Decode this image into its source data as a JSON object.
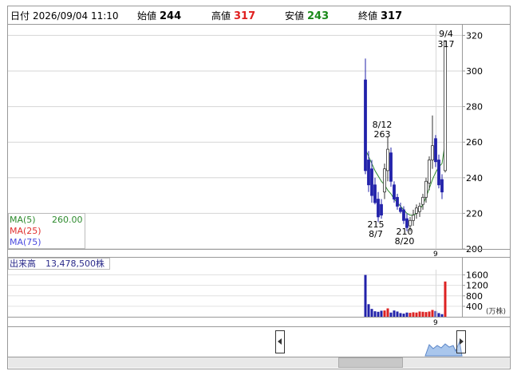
{
  "header": {
    "date_label": "日付",
    "datetime": "2026/09/04 11:10",
    "open_label": "始値",
    "open_value": "244",
    "high_label": "高値",
    "high_value": "317",
    "low_label": "安値",
    "low_value": "243",
    "close_label": "終値",
    "close_value": "317"
  },
  "ma_legend": {
    "ma5_label": "MA(5)",
    "ma5_value": "260.00",
    "ma25_label": "MA(25)",
    "ma75_label": "MA(75)"
  },
  "volume_label": "出来高",
  "volume_value": "13,478,500株",
  "volume_unit": "(万株)",
  "colors": {
    "up": "#ffffff",
    "down": "#2222aa",
    "ma5": "#2e8b2e",
    "ma25": "#e03030",
    "ma75": "#4a4ae0",
    "vol_up": "#dd2222",
    "vol_down": "#2222aa"
  },
  "chart_data": [
    {
      "type": "candlestick",
      "y_ticks": [
        "320",
        "300",
        "280",
        "260",
        "240",
        "220",
        "200"
      ],
      "ylim": [
        200,
        326
      ],
      "x_tick_label": "9",
      "annotations": [
        {
          "date": "9/4",
          "price": "317"
        },
        {
          "date": "8/12",
          "price": "263"
        },
        {
          "date": "8/7",
          "price": "215"
        },
        {
          "date": "8/20",
          "price": "210"
        }
      ],
      "candles": [
        {
          "o": 295,
          "h": 307,
          "l": 242,
          "c": 244
        },
        {
          "o": 250,
          "h": 255,
          "l": 232,
          "c": 236
        },
        {
          "o": 245,
          "h": 250,
          "l": 226,
          "c": 230
        },
        {
          "o": 236,
          "h": 240,
          "l": 225,
          "c": 226
        },
        {
          "o": 228,
          "h": 232,
          "l": 215,
          "c": 218
        },
        {
          "o": 225,
          "h": 228,
          "l": 217,
          "c": 219
        },
        {
          "o": 232,
          "h": 248,
          "l": 228,
          "c": 245
        },
        {
          "o": 244,
          "h": 263,
          "l": 238,
          "c": 256
        },
        {
          "o": 254,
          "h": 257,
          "l": 235,
          "c": 238
        },
        {
          "o": 236,
          "h": 238,
          "l": 226,
          "c": 228
        },
        {
          "o": 229,
          "h": 231,
          "l": 222,
          "c": 224
        },
        {
          "o": 223,
          "h": 226,
          "l": 220,
          "c": 221
        },
        {
          "o": 222,
          "h": 224,
          "l": 214,
          "c": 216
        },
        {
          "o": 217,
          "h": 220,
          "l": 210,
          "c": 212
        },
        {
          "o": 213,
          "h": 218,
          "l": 210,
          "c": 216
        },
        {
          "o": 216,
          "h": 222,
          "l": 213,
          "c": 219
        },
        {
          "o": 220,
          "h": 225,
          "l": 217,
          "c": 223
        },
        {
          "o": 221,
          "h": 226,
          "l": 218,
          "c": 224
        },
        {
          "o": 225,
          "h": 231,
          "l": 222,
          "c": 229
        },
        {
          "o": 229,
          "h": 240,
          "l": 226,
          "c": 238
        },
        {
          "o": 237,
          "h": 252,
          "l": 233,
          "c": 250
        },
        {
          "o": 250,
          "h": 275,
          "l": 245,
          "c": 258
        },
        {
          "o": 262,
          "h": 264,
          "l": 246,
          "c": 249
        },
        {
          "o": 250,
          "h": 253,
          "l": 234,
          "c": 236
        },
        {
          "o": 239,
          "h": 242,
          "l": 228,
          "c": 232
        },
        {
          "o": 244,
          "h": 317,
          "l": 243,
          "c": 317
        }
      ],
      "ma5": [
        256,
        252,
        248,
        244,
        241,
        238,
        236,
        233,
        231,
        228,
        226,
        224,
        222,
        220,
        219,
        219,
        220,
        222,
        225,
        229,
        234,
        239,
        243,
        246,
        248,
        260
      ]
    },
    {
      "type": "bar",
      "title": "出来高",
      "y_ticks": [
        "1600",
        "1200",
        "800",
        "400"
      ],
      "ylim": [
        0,
        1800
      ],
      "unit": "(万株)",
      "values": [
        1600,
        480,
        300,
        210,
        190,
        230,
        240,
        320,
        160,
        240,
        200,
        140,
        120,
        160,
        150,
        170,
        160,
        200,
        190,
        180,
        200,
        260,
        220,
        140,
        100,
        1348
      ],
      "colors_by": "up_down",
      "up": [
        false,
        false,
        false,
        false,
        false,
        false,
        true,
        true,
        false,
        false,
        false,
        false,
        false,
        false,
        true,
        true,
        true,
        true,
        true,
        true,
        true,
        true,
        false,
        false,
        false,
        true
      ]
    }
  ]
}
